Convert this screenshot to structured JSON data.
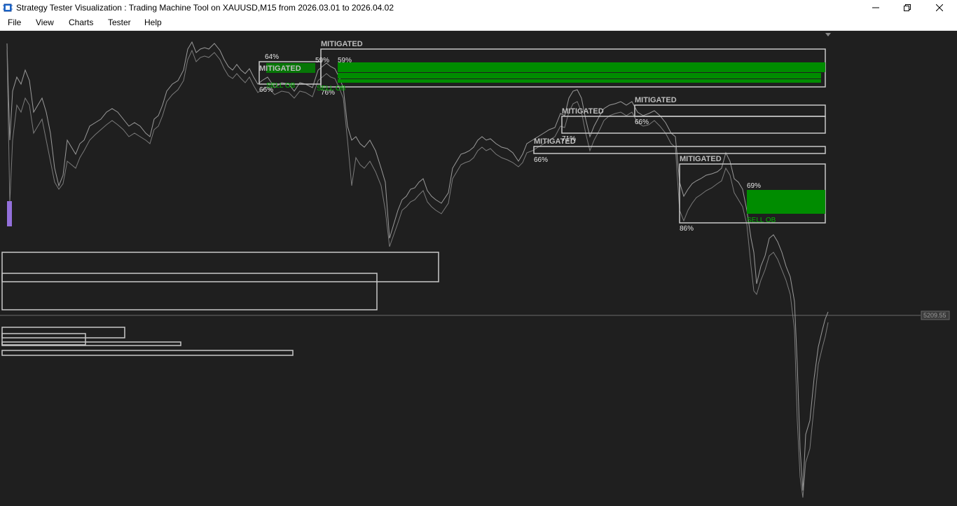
{
  "window": {
    "title": "Strategy Tester Visualization : Trading Machine Tool on XAUUSD,M15 from 2026.03.01 to 2026.04.02",
    "controls": {
      "minimize_icon": "minimize-icon",
      "restore_icon": "restore-icon",
      "close_icon": "close-icon"
    }
  },
  "menu": {
    "items": [
      {
        "label": "File"
      },
      {
        "label": "View"
      },
      {
        "label": "Charts"
      },
      {
        "label": "Tester"
      },
      {
        "label": "Help"
      }
    ]
  },
  "chart": {
    "colors": {
      "background": "#1f1f1f",
      "price_line": "#8c8c8c",
      "zone_border": "#c8c8c8",
      "zone_fill": "#008c00",
      "zone_text": "#00b400",
      "label_text": "#e6e6e6",
      "mitigated_text": "#bdbdbd",
      "marker": "#9370db"
    },
    "current_price": "5209.55",
    "labels": {
      "mitigated_1": "MITIGATED",
      "mitigated_2": "MITIGATED",
      "mitigated_3": "MITIGATED",
      "mitigated_4": "MITIGATED",
      "mitigated_5": "MITIGATED",
      "mitigated_6": "MITIGATED",
      "pct_64": "64%",
      "pct_59a": "59%",
      "pct_59b": "59%",
      "pct_66a": "66%",
      "pct_76": "76%",
      "pct_66b": "66%",
      "pct_71": "71%",
      "pct_66c": "66%",
      "pct_86": "86%",
      "pct_69": "69%",
      "sell_ob_1": "SELL OB",
      "sell_ob_2": "SELL OB",
      "sell_ob_3": "SELL OB"
    }
  }
}
